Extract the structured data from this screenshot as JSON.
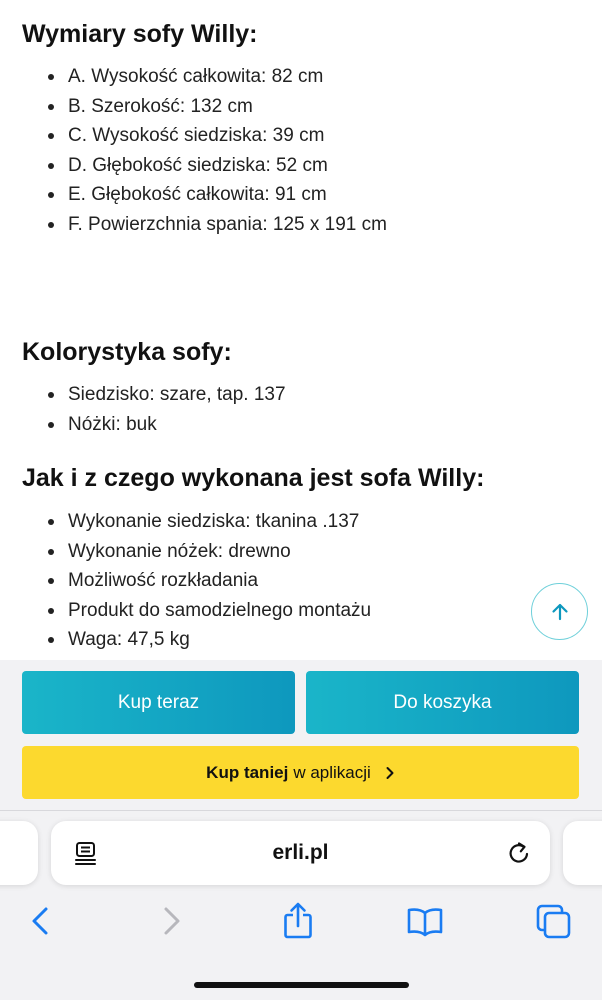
{
  "sections": {
    "dimensions": {
      "title": "Wymiary sofy Willy:",
      "items": [
        "A. Wysokość całkowita: 82 cm",
        "B. Szerokość: 132 cm",
        "C. Wysokość siedziska: 39 cm",
        "D. Głębokość siedziska: 52 cm",
        "E. Głębokość całkowita: 91 cm",
        "F. Powierzchnia spania: 125 x 191 cm"
      ]
    },
    "colors": {
      "title": "Kolorystyka sofy:",
      "items": [
        "Siedzisko: szare, tap. 137",
        "Nóżki: buk"
      ]
    },
    "materials": {
      "title": "Jak i z czego wykonana jest sofa Willy:",
      "items": [
        "Wykonanie siedziska: tkanina .137",
        "Wykonanie nóżek: drewno",
        "Możliwość rozkładania",
        "Produkt do samodzielnego montażu",
        "Waga: 47,5 kg"
      ]
    }
  },
  "actions": {
    "buy_now": "Kup teraz",
    "add_to_cart": "Do koszyka",
    "app_banner_bold": "Kup taniej",
    "app_banner_rest": "w aplikacji"
  },
  "browser": {
    "url": "erli.pl"
  },
  "colors": {
    "accent_teal": "#0e98be",
    "banner_yellow": "#fcd92e",
    "ios_blue": "#1a7cf2"
  },
  "icons": [
    "arrow-up-icon",
    "chevron-right-icon",
    "reader-icon",
    "reload-icon",
    "back-icon",
    "forward-icon",
    "share-icon",
    "bookmarks-icon",
    "tabs-icon"
  ]
}
